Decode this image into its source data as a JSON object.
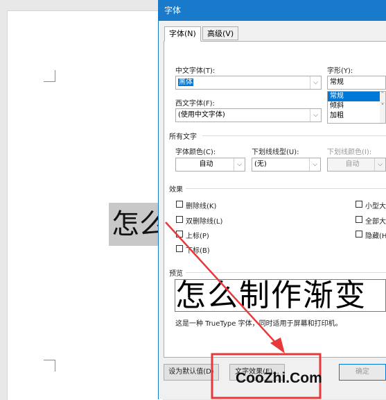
{
  "document": {
    "text": "怎么"
  },
  "dialog": {
    "title": "字体",
    "tabs": [
      {
        "label": "字体(N)"
      },
      {
        "label": "高级(V)"
      }
    ],
    "chinese_font": {
      "label": "中文字体(T):",
      "value": "黑体"
    },
    "western_font": {
      "label": "西文字体(F):",
      "value": "(使用中文字体)"
    },
    "style": {
      "label": "字形(Y):",
      "value": "常规",
      "options": [
        "常规",
        "倾斜",
        "加粗"
      ]
    },
    "all_text": {
      "title": "所有文字",
      "font_color": {
        "label": "字体颜色(C):",
        "value": "自动"
      },
      "underline_style": {
        "label": "下划线线型(U):",
        "value": "(无)"
      },
      "underline_color": {
        "label": "下划线颜色(I):",
        "value": "自动"
      }
    },
    "effects": {
      "title": "效果",
      "left": [
        "删除线(K)",
        "双删除线(L)",
        "上标(P)",
        "下标(B)"
      ],
      "right": [
        "小型大",
        "全部大",
        "隐藏(H"
      ]
    },
    "preview": {
      "title": "预览",
      "text": "怎么制作渐变",
      "note": "这是一种 TrueType 字体，同时适用于屏幕和打印机。"
    },
    "buttons": {
      "set_default": "设为默认值(D)",
      "text_effects": "文字效果(E)...",
      "ok": "确定"
    }
  },
  "watermark": "CooZhi.Com",
  "colors": {
    "accent": "#1979ca",
    "annotation": "#e8383a"
  }
}
